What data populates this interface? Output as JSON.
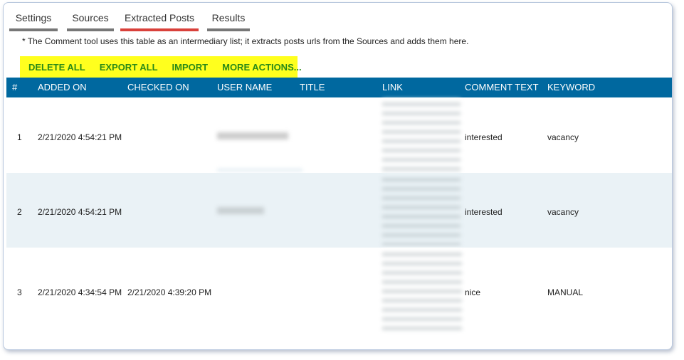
{
  "tabs": [
    {
      "label": "Settings",
      "active": false
    },
    {
      "label": "Sources",
      "active": false
    },
    {
      "label": "Extracted Posts",
      "active": true
    },
    {
      "label": "Results",
      "active": false
    }
  ],
  "note": "* The Comment tool uses this table as an intermediary list; it extracts posts urls from the Sources and adds them here.",
  "actions": {
    "delete_all": "DELETE ALL",
    "export_all": "EXPORT ALL",
    "import": "IMPORT",
    "more_actions": "MORE ACTIONS..."
  },
  "colors": {
    "header_bg": "#00689f",
    "action_bar_bg": "#ffff1e",
    "action_text": "#2a8a17",
    "active_tab_underline": "#d9413b",
    "alt_row_bg": "#eaf2f6"
  },
  "table": {
    "headers": [
      "#",
      "ADDED ON",
      "CHECKED ON",
      "USER NAME",
      "TITLE",
      "LINK",
      "COMMENT TEXT",
      "KEYWORD"
    ],
    "rows": [
      {
        "num": "1",
        "added_on": "2/21/2020 4:54:21 PM",
        "checked_on": "",
        "comment_text": "interested",
        "keyword": "vacancy"
      },
      {
        "num": "2",
        "added_on": "2/21/2020 4:54:21 PM",
        "checked_on": "",
        "comment_text": "interested",
        "keyword": "vacancy"
      },
      {
        "num": "3",
        "added_on": "2/21/2020 4:34:54 PM",
        "checked_on": "2/21/2020 4:39:20 PM",
        "comment_text": "nice",
        "keyword": "MANUAL"
      }
    ]
  }
}
